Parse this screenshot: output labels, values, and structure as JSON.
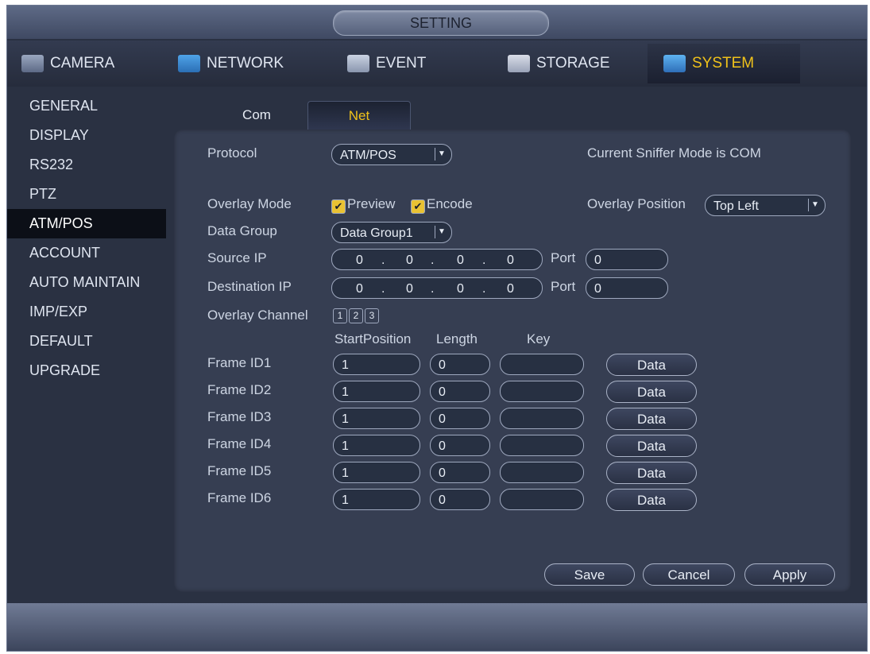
{
  "window": {
    "title": "SETTING"
  },
  "tabs": [
    {
      "label": "CAMERA",
      "icon": "camera-icon",
      "active": false
    },
    {
      "label": "NETWORK",
      "icon": "network-icon",
      "active": false
    },
    {
      "label": "EVENT",
      "icon": "event-icon",
      "active": false
    },
    {
      "label": "STORAGE",
      "icon": "storage-icon",
      "active": false
    },
    {
      "label": "SYSTEM",
      "icon": "system-icon",
      "active": true
    }
  ],
  "sidebar": {
    "items": [
      {
        "label": "GENERAL"
      },
      {
        "label": "DISPLAY"
      },
      {
        "label": "RS232"
      },
      {
        "label": "PTZ"
      },
      {
        "label": "ATM/POS",
        "active": true
      },
      {
        "label": "ACCOUNT"
      },
      {
        "label": "AUTO MAINTAIN"
      },
      {
        "label": "IMP/EXP"
      },
      {
        "label": "DEFAULT"
      },
      {
        "label": "UPGRADE"
      }
    ]
  },
  "subtabs": [
    {
      "label": "Com",
      "active": false
    },
    {
      "label": "Net",
      "active": true
    }
  ],
  "form": {
    "protocol_label": "Protocol",
    "protocol_value": "ATM/POS",
    "sniffer_status": "Current Sniffer Mode is COM",
    "overlay_mode_label": "Overlay Mode",
    "overlay_preview": "Preview",
    "overlay_encode": "Encode",
    "overlay_position_label": "Overlay Position",
    "overlay_position_value": "Top Left",
    "data_group_label": "Data Group",
    "data_group_value": "Data Group1",
    "source_ip_label": "Source IP",
    "source_ip": [
      "0",
      "0",
      "0",
      "0"
    ],
    "source_port_label": "Port",
    "source_port": "0",
    "dest_ip_label": "Destination IP",
    "dest_ip": [
      "0",
      "0",
      "0",
      "0"
    ],
    "dest_port_label": "Port",
    "dest_port": "0",
    "overlay_channel_label": "Overlay Channel",
    "channels": [
      "1",
      "2",
      "3"
    ],
    "col_start": "StartPosition",
    "col_length": "Length",
    "col_key": "Key",
    "frames": [
      {
        "label": "Frame ID1",
        "start": "1",
        "length": "0",
        "key": "",
        "button": "Data"
      },
      {
        "label": "Frame ID2",
        "start": "1",
        "length": "0",
        "key": "",
        "button": "Data"
      },
      {
        "label": "Frame ID3",
        "start": "1",
        "length": "0",
        "key": "",
        "button": "Data"
      },
      {
        "label": "Frame ID4",
        "start": "1",
        "length": "0",
        "key": "",
        "button": "Data"
      },
      {
        "label": "Frame ID5",
        "start": "1",
        "length": "0",
        "key": "",
        "button": "Data"
      },
      {
        "label": "Frame ID6",
        "start": "1",
        "length": "0",
        "key": "",
        "button": "Data"
      }
    ]
  },
  "buttons": {
    "save": "Save",
    "cancel": "Cancel",
    "apply": "Apply"
  },
  "colors": {
    "accent": "#f0c21a",
    "panel": "#363e52",
    "background": "#2a3142"
  }
}
